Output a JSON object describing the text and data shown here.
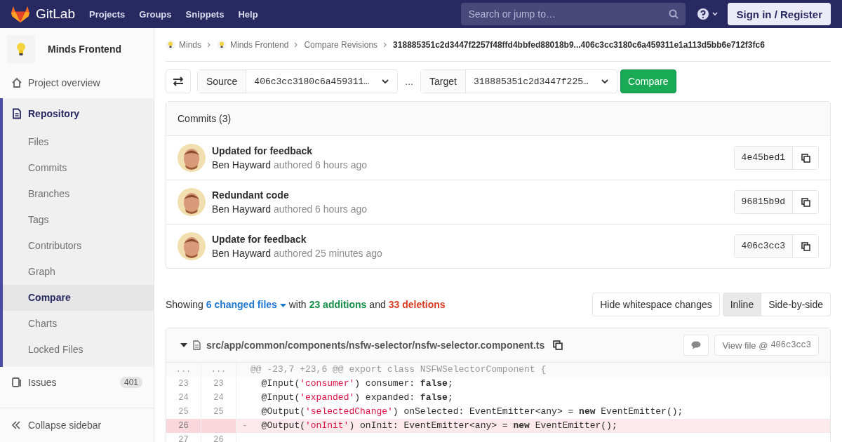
{
  "topbar": {
    "brand": "GitLab",
    "nav": [
      "Projects",
      "Groups",
      "Snippets",
      "Help"
    ],
    "search": {
      "placeholder": "Search or jump to…"
    },
    "sign_in": "Sign in / Register"
  },
  "sidebar": {
    "project": "Minds Frontend",
    "items": [
      {
        "label": "Project overview",
        "kind": "home",
        "selected": false
      },
      {
        "label": "Repository",
        "kind": "repository",
        "selected": true,
        "children": [
          {
            "label": "Files",
            "selected": false
          },
          {
            "label": "Commits",
            "selected": false
          },
          {
            "label": "Branches",
            "selected": false
          },
          {
            "label": "Tags",
            "selected": false
          },
          {
            "label": "Contributors",
            "selected": false
          },
          {
            "label": "Graph",
            "selected": false
          },
          {
            "label": "Compare",
            "selected": true
          },
          {
            "label": "Charts",
            "selected": false
          },
          {
            "label": "Locked Files",
            "selected": false
          }
        ]
      },
      {
        "label": "Issues",
        "kind": "issues",
        "selected": false,
        "count": "401"
      }
    ],
    "collapse": "Collapse sidebar"
  },
  "breadcrumb": [
    {
      "label": "Minds",
      "kind": "project"
    },
    {
      "label": "Minds Frontend",
      "kind": "project"
    },
    {
      "label": "Compare Revisions",
      "kind": "page"
    },
    {
      "label": "318885351c2d3447f2257f48ffd4bbfed88018b9...406c3cc3180c6a459311e1a113d5bb6e712f3fc6",
      "kind": "current"
    }
  ],
  "compare": {
    "source_label": "Source",
    "source": "406c3cc3180c6a459311…",
    "separator": "...",
    "target_label": "Target",
    "target": "318885351c2d3447f225…",
    "button": "Compare"
  },
  "commits": {
    "title": "Commits (3)",
    "rows": [
      {
        "title": "Updated for feedback",
        "author": "Ben Hayward",
        "time": "authored 6 hours ago",
        "sha": "4e45bed1"
      },
      {
        "title": "Redundant code",
        "author": "Ben Hayward",
        "time": "authored 6 hours ago",
        "sha": "96815b9d"
      },
      {
        "title": "Update for feedback",
        "author": "Ben Hayward",
        "time": "authored 25 minutes ago",
        "sha": "406c3cc3"
      }
    ]
  },
  "summary": {
    "showing": "Showing",
    "files": "6 changed files",
    "with": "with",
    "additions": "23 additions",
    "and": "and",
    "deletions": "33 deletions"
  },
  "view_buttons": {
    "whitespace": "Hide whitespace changes",
    "modes": [
      {
        "label": "Inline",
        "selected": true
      },
      {
        "label": "Side-by-side",
        "selected": false
      }
    ]
  },
  "file": {
    "path": "src/app/common/components/nsfw-selector/nsfw-selector.component.ts",
    "view_file": "View file @",
    "view_sha": "406c3cc3",
    "lines": [
      {
        "kind": "match",
        "old": "...",
        "new": "...",
        "segments": [
          {
            "text": "@@ -23,7 +23,6 @@ export class NSFWSelectorComponent {",
            "kind": "plain"
          }
        ]
      },
      {
        "kind": "context",
        "old": "23",
        "new": "23",
        "segments": [
          {
            "text": "  @Input(",
            "kind": "plain"
          },
          {
            "text": "'consumer'",
            "kind": "string"
          },
          {
            "text": ") consumer: ",
            "kind": "plain"
          },
          {
            "text": "false",
            "kind": "keyword"
          },
          {
            "text": ";",
            "kind": "plain"
          }
        ]
      },
      {
        "kind": "context",
        "old": "24",
        "new": "24",
        "segments": [
          {
            "text": "  @Input(",
            "kind": "plain"
          },
          {
            "text": "'expanded'",
            "kind": "string"
          },
          {
            "text": ") expanded: ",
            "kind": "plain"
          },
          {
            "text": "false",
            "kind": "keyword"
          },
          {
            "text": ";",
            "kind": "plain"
          }
        ]
      },
      {
        "kind": "context",
        "old": "25",
        "new": "25",
        "segments": [
          {
            "text": "  @Output(",
            "kind": "plain"
          },
          {
            "text": "'selectedChange'",
            "kind": "string"
          },
          {
            "text": ") onSelected: EventEmitter<any> = ",
            "kind": "plain"
          },
          {
            "text": "new",
            "kind": "keyword"
          },
          {
            "text": " EventEmitter();",
            "kind": "plain"
          }
        ]
      },
      {
        "kind": "removed",
        "old": "26",
        "marker": "-",
        "segments": [
          {
            "text": "  @Output(",
            "kind": "plain"
          },
          {
            "text": "'onInit'",
            "kind": "string"
          },
          {
            "text": ") onInit: EventEmitter<any> = ",
            "kind": "plain"
          },
          {
            "text": "new",
            "kind": "keyword"
          },
          {
            "text": " EventEmitter();",
            "kind": "plain"
          }
        ]
      },
      {
        "kind": "context",
        "old": "27",
        "new": "26"
      }
    ]
  }
}
